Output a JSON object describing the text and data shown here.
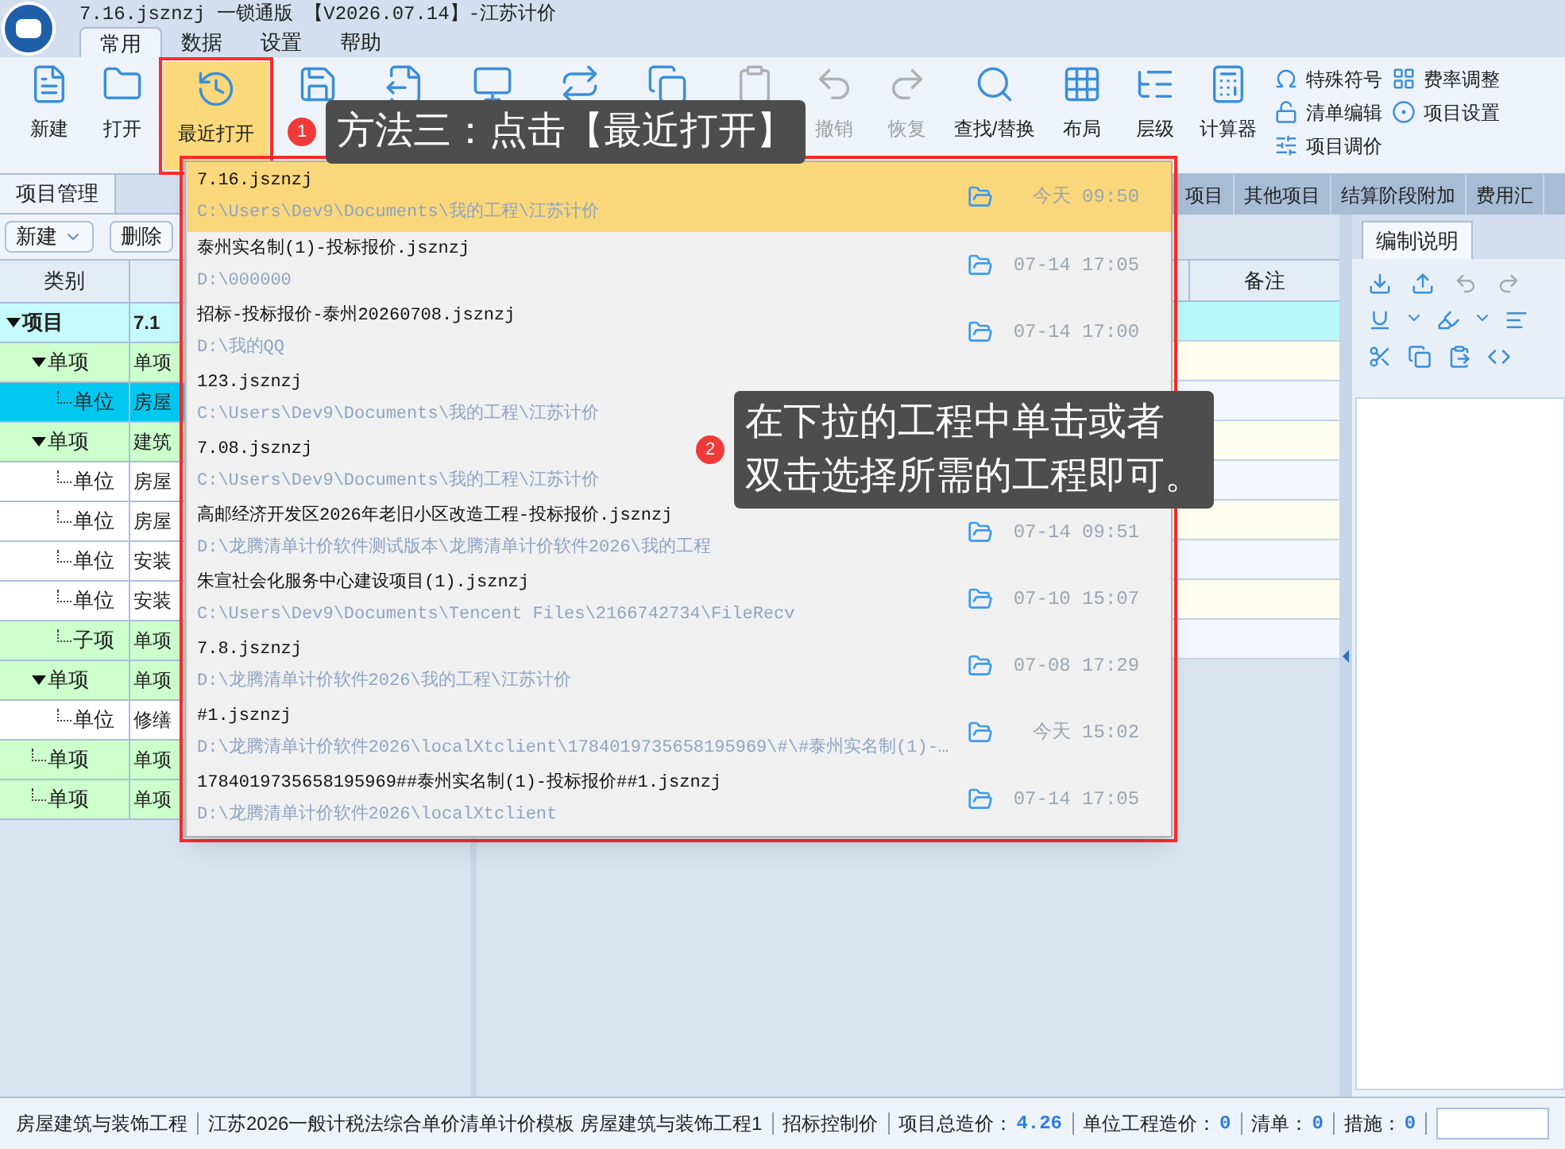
{
  "window": {
    "title": "7.16.jsznzj 一锁通版 【V2026.07.14】-江苏计价"
  },
  "menu_tabs": [
    {
      "label": "常用",
      "selected": true
    },
    {
      "label": "数据",
      "selected": false
    },
    {
      "label": "设置",
      "selected": false
    },
    {
      "label": "帮助",
      "selected": false
    }
  ],
  "ribbon": {
    "buttons": [
      {
        "label": "新建",
        "disabled": false,
        "highlighted": false
      },
      {
        "label": "打开",
        "disabled": false,
        "highlighted": false
      },
      {
        "label": "最近打开",
        "disabled": false,
        "highlighted": true
      },
      {
        "disabled": false,
        "highlighted": false
      },
      {
        "disabled": false,
        "highlighted": false
      },
      {
        "disabled": false,
        "highlighted": false
      },
      {
        "disabled": false,
        "highlighted": false
      },
      {
        "disabled": false,
        "highlighted": false
      },
      {
        "disabled": true,
        "highlighted": false
      },
      {
        "label": "撤销",
        "disabled": true,
        "highlighted": false
      },
      {
        "label": "恢复",
        "disabled": true,
        "highlighted": false
      },
      {
        "label": "查找/替换",
        "disabled": false,
        "highlighted": false
      },
      {
        "label": "布局",
        "disabled": false,
        "highlighted": false
      },
      {
        "label": "层级",
        "disabled": false,
        "highlighted": false
      },
      {
        "label": "计算器",
        "disabled": false,
        "highlighted": false
      }
    ],
    "small_items": [
      "特殊符号",
      "清单编辑",
      "项目调价",
      "费率调整",
      "项目设置"
    ]
  },
  "left_panel": {
    "tab": "项目管理",
    "toolbar": [
      {
        "label": "新建",
        "dropdown": true
      },
      {
        "label": "删除",
        "dropdown": false
      }
    ],
    "columns": [
      "类别"
    ],
    "tree": [
      {
        "kind": "project",
        "label": "项目",
        "value": "7.1",
        "selected": false,
        "expanded": true,
        "children": [
          {
            "kind": "section",
            "label": "单项",
            "value": "单项",
            "selected": false,
            "expanded": true,
            "children": [
              {
                "kind": "unit",
                "label": "单位",
                "value": "房屋",
                "selected": true
              }
            ]
          },
          {
            "kind": "section",
            "label": "单项",
            "value": "建筑",
            "selected": false,
            "expanded": true,
            "children": [
              {
                "kind": "unit",
                "label": "单位",
                "value": "房屋",
                "selected": false
              },
              {
                "kind": "unit",
                "label": "单位",
                "value": "房屋",
                "selected": false
              },
              {
                "kind": "unit",
                "label": "单位",
                "value": "安装",
                "selected": false
              },
              {
                "kind": "unit",
                "label": "单位",
                "value": "安装",
                "selected": false
              },
              {
                "kind": "subitem",
                "label": "子项",
                "value": "单项",
                "selected": false
              }
            ]
          },
          {
            "kind": "section",
            "label": "单项",
            "value": "单项",
            "selected": false,
            "expanded": true,
            "children": [
              {
                "kind": "unit",
                "label": "单位",
                "value": "修缮",
                "selected": false
              }
            ]
          },
          {
            "kind": "section",
            "label": "单项",
            "value": "单项",
            "selected": false
          },
          {
            "kind": "section",
            "label": "单项",
            "value": "单项",
            "selected": false
          }
        ]
      }
    ]
  },
  "center_panel": {
    "tabs": [
      "项目",
      "其他项目",
      "结算阶段附加",
      "费用汇"
    ],
    "columns": [
      "备注"
    ]
  },
  "right_panel": {
    "tab": "编制说明"
  },
  "recent_dropdown": {
    "items": [
      {
        "name": "7.16.jsznzj",
        "path": "C:\\Users\\Dev9\\Documents\\我的工程\\江苏计价",
        "time": "今天 09:50",
        "selected": true
      },
      {
        "name": "泰州实名制(1)-投标报价.jsznzj",
        "path": "D:\\000000",
        "time": "07-14 17:05",
        "selected": false
      },
      {
        "name": "招标-投标报价-泰州20260708.jsznzj",
        "path": "D:\\我的QQ",
        "time": "07-14 17:00",
        "selected": false
      },
      {
        "name": "123.jsznzj",
        "path": "C:\\Users\\Dev9\\Documents\\我的工程\\江苏计价",
        "selected": false
      },
      {
        "name": "7.08.jsznzj",
        "path": "C:\\Users\\Dev9\\Documents\\我的工程\\江苏计价",
        "selected": false
      },
      {
        "name": "高邮经济开发区2026年老旧小区改造工程-投标报价.jsznzj",
        "path": "D:\\龙腾清单计价软件测试版本\\龙腾清单计价软件2026\\我的工程",
        "time": "07-14 09:51",
        "selected": false
      },
      {
        "name": "朱宣社会化服务中心建设项目(1).jsznzj",
        "path": "C:\\Users\\Dev9\\Documents\\Tencent Files\\2166742734\\FileRecv",
        "time": "07-10 15:07",
        "selected": false
      },
      {
        "name": "7.8.jsznzj",
        "path": "D:\\龙腾清单计价软件2026\\我的工程\\江苏计价",
        "time": "07-08 17:29",
        "selected": false
      },
      {
        "name": "#1.jsznzj",
        "path": "D:\\龙腾清单计价软件2026\\localXtclient\\1784019735658195969\\#\\#泰州实名制(1)-…",
        "time": "今天 15:02",
        "selected": false
      },
      {
        "name": "1784019735658195969##泰州实名制(1)-投标报价##1.jsznzj",
        "path": "D:\\龙腾清单计价软件2026\\localXtclient",
        "time": "07-14 17:05",
        "selected": false
      }
    ]
  },
  "callouts": [
    {
      "number": "1",
      "lines": [
        "方法三：点击【最近打开】"
      ]
    },
    {
      "number": "2",
      "lines": [
        "在下拉的工程中单击或者",
        "双击选择所需的工程即可。"
      ]
    }
  ],
  "status_bar": [
    {
      "label": "房屋建筑与装饰工程"
    },
    {
      "label": "江苏2026一般计税法综合单价清单计价模板 房屋建筑与装饰工程1"
    },
    {
      "label": "招标控制价"
    },
    {
      "label": "项目总造价：",
      "value": "4.26"
    },
    {
      "label": "单位工程造价：",
      "value": "0"
    },
    {
      "label": "清单：",
      "value": "0"
    },
    {
      "label": "措施：",
      "value": "0"
    }
  ]
}
